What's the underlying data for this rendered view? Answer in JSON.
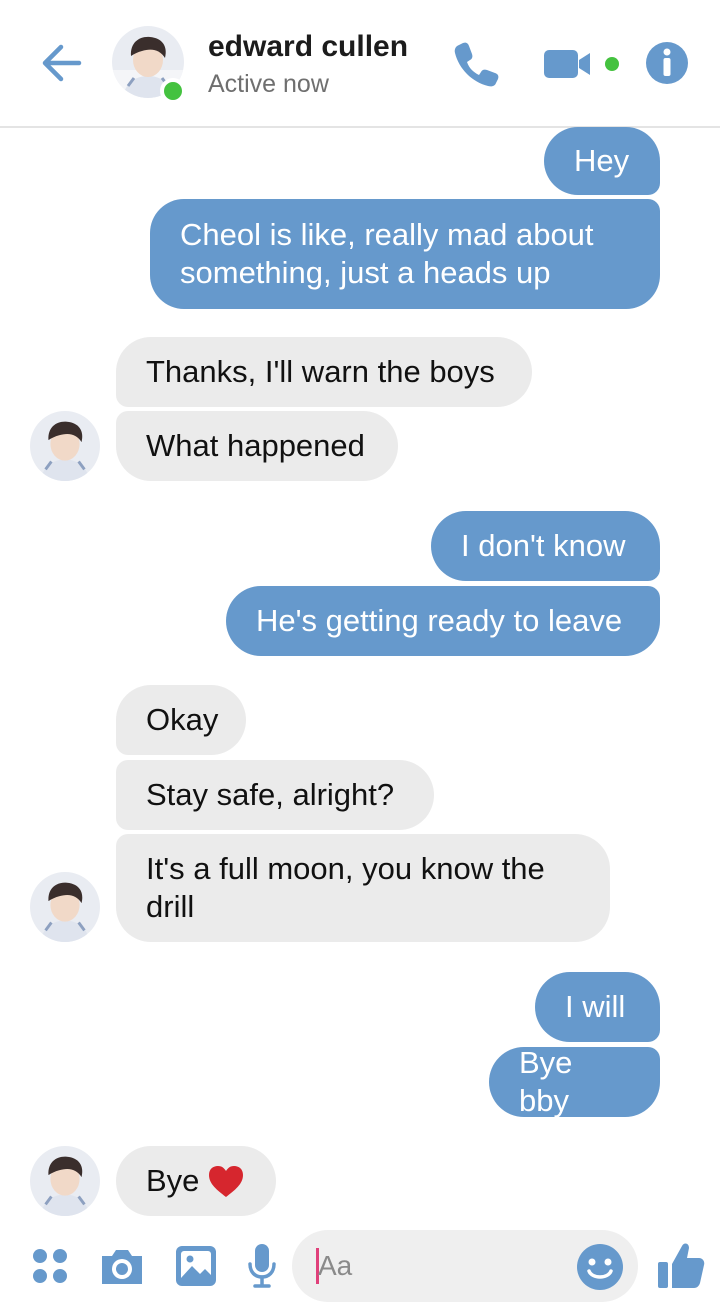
{
  "colors": {
    "accent": "#6699cc",
    "outgoing_bubble": "#6699cc",
    "incoming_bubble": "#ebebeb",
    "active_dot": "#44c23f",
    "heart": "#d6262e"
  },
  "header": {
    "contact_name": "edward cullen",
    "status": "Active now",
    "icons": [
      "back-arrow-icon",
      "phone-icon",
      "video-camera-icon",
      "info-icon"
    ]
  },
  "messages": [
    {
      "direction": "outgoing",
      "text": "Hey"
    },
    {
      "direction": "outgoing",
      "text": "Cheol is like, really mad about something, just a heads up"
    },
    {
      "direction": "incoming",
      "text": "Thanks, I'll warn the boys"
    },
    {
      "direction": "incoming",
      "text": "What happened"
    },
    {
      "direction": "outgoing",
      "text": "I don't know"
    },
    {
      "direction": "outgoing",
      "text": "He's getting ready to leave"
    },
    {
      "direction": "incoming",
      "text": "Okay"
    },
    {
      "direction": "incoming",
      "text": "Stay safe, alright?"
    },
    {
      "direction": "incoming",
      "text": "It's a full moon, you know the drill"
    },
    {
      "direction": "outgoing",
      "text": "I will"
    },
    {
      "direction": "outgoing",
      "text": "Bye bby"
    },
    {
      "direction": "incoming",
      "text": "Bye",
      "emoji": "heart-icon"
    }
  ],
  "composer": {
    "placeholder": "Aa",
    "icons": [
      "apps-grid-icon",
      "camera-icon",
      "image-icon",
      "microphone-icon",
      "emoji-icon",
      "thumbs-up-icon"
    ]
  }
}
